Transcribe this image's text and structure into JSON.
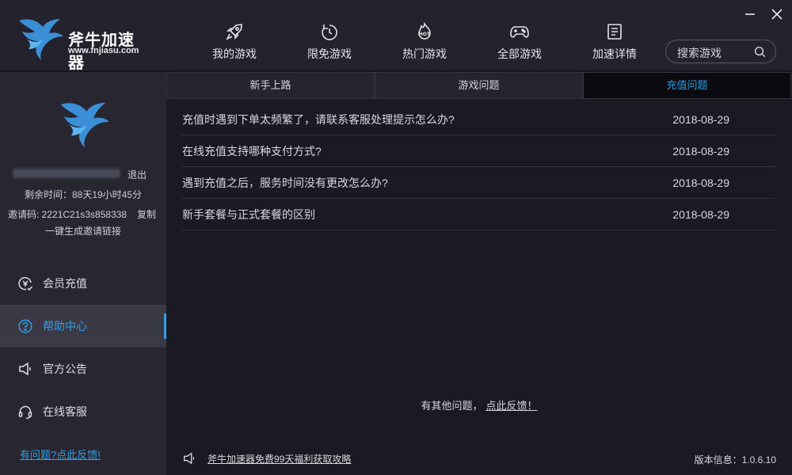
{
  "brand": {
    "name": "斧牛加速器",
    "url": "www.fnjiasu.com"
  },
  "nav": [
    {
      "label": "我的游戏",
      "icon": "rocket-icon"
    },
    {
      "label": "限免游戏",
      "icon": "timer-icon"
    },
    {
      "label": "热门游戏",
      "icon": "hot-icon"
    },
    {
      "label": "全部游戏",
      "icon": "gamepad-icon"
    },
    {
      "label": "加速详情",
      "icon": "document-icon"
    }
  ],
  "search": {
    "placeholder": "搜索游戏"
  },
  "user": {
    "logout": "退出",
    "remaining": "剩余时间：88天19小时45分",
    "invite": "邀请码: 2221C21s3s858338",
    "copy": "复制",
    "gen_link": "一键生成邀请链接"
  },
  "menu": [
    {
      "label": "会员充值",
      "icon": "recharge-icon",
      "active": false
    },
    {
      "label": "帮助中心",
      "icon": "help-icon",
      "active": true
    },
    {
      "label": "官方公告",
      "icon": "speaker-icon",
      "active": false
    },
    {
      "label": "在线客服",
      "icon": "headset-icon",
      "active": false
    }
  ],
  "sidebar_feedback": "有问题?点此反馈!",
  "tabs": [
    {
      "label": "新手上路",
      "active": false
    },
    {
      "label": "游戏问题",
      "active": false
    },
    {
      "label": "充值问题",
      "active": true
    }
  ],
  "questions": [
    {
      "title": "充值时遇到下单太频繁了，请联系客服处理提示怎么办?",
      "date": "2018-08-29"
    },
    {
      "title": "在线充值支持哪种支付方式?",
      "date": "2018-08-29"
    },
    {
      "title": "遇到充值之后，服务时间没有更改怎么办?",
      "date": "2018-08-29"
    },
    {
      "title": "新手套餐与正式套餐的区别",
      "date": "2018-08-29"
    }
  ],
  "other_question": {
    "text": "有其他问题，",
    "link": "点此反馈！"
  },
  "footer": {
    "notice": "斧牛加速器免费99天福利获取攻略",
    "version": "版本信息：1.0.6.10"
  },
  "colors": {
    "accent": "#2ea0e6",
    "background": "#1b1a24",
    "sidebar": "#272631",
    "header": "#23222d"
  }
}
